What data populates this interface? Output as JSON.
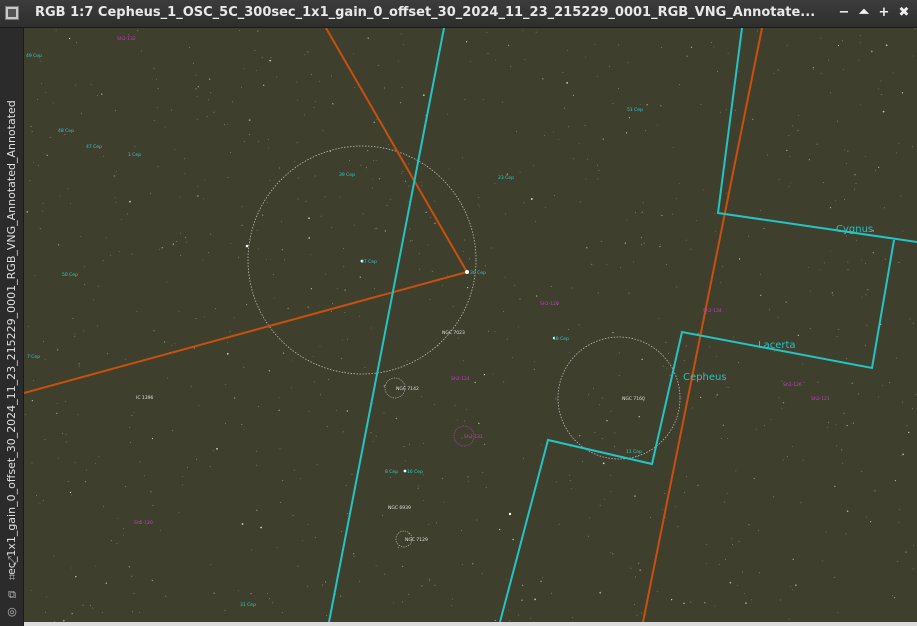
{
  "window": {
    "title": "RGB 1:7 Cepheus_1_OSC_5C_300sec_1x1_gain_0_offset_30_2024_11_23_215229_0001_RGB_VNG_Annotate...",
    "vertical_title": "ec_1x1_gain_0_offset_30_2024_11_23_215229_0001_RGB_VNG_Annotated_Annotated",
    "buttons": {
      "minimize": "−",
      "shade": "⏶",
      "maximize": "+",
      "close": "✖"
    }
  },
  "side_toolbar": {
    "icons": [
      "link-icon",
      "fit-icon",
      "copy-icon",
      "target-icon"
    ]
  },
  "image": {
    "constellations": [
      "Cygnus",
      "Lacerta",
      "Cepheus"
    ],
    "colors": {
      "sky": "#3f3f2d",
      "constellation_boundary": "#25c4c4",
      "ecliptic_line": "#c8500f",
      "star_label": "#2ed0c8",
      "nebula_label": "#c040c0",
      "circle": "#bdbdbd"
    },
    "star_labels": [
      "49 Cep",
      "48 Cep",
      "47 Cep",
      "1 Cep",
      "50 Cep",
      "39 Cep",
      "17 Cep",
      "30 Cep",
      "23 Cep",
      "18 Cep",
      "51 Cep",
      "11 Cep",
      "8 Cep",
      "16 Cep",
      "7 Cep",
      "31 Cep"
    ],
    "nebula_labels": [
      "Sh2-132",
      "Sh2-129",
      "Sh2-124",
      "Sh2-134",
      "Sh2-131",
      "Sh2-126",
      "Sh2-121",
      "Sh2-120"
    ],
    "object_labels": [
      "NGC 7160",
      "NGC 7142",
      "IC 1396",
      "NGC 7129",
      "NGC 6939",
      "NGC 7023"
    ]
  }
}
